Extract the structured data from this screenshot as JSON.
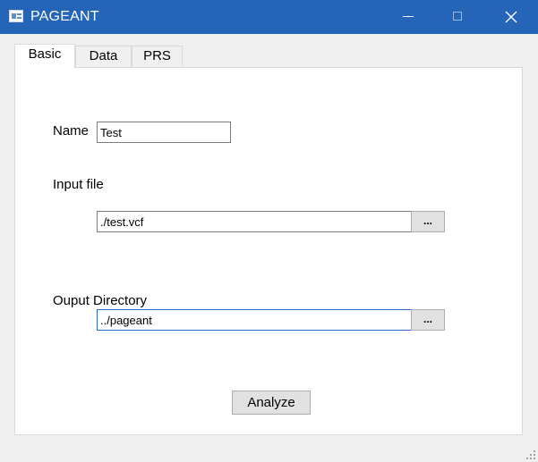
{
  "window": {
    "title": "PAGEANT",
    "icons": {
      "app": "window-app-icon",
      "minimize": "minimize-icon",
      "maximize": "maximize-icon",
      "close": "close-icon"
    },
    "colors": {
      "titlebar": "#2465b8",
      "focus_border": "#2a6fc4"
    }
  },
  "tabs": [
    {
      "label": "Basic",
      "selected": true
    },
    {
      "label": "Data",
      "selected": false
    },
    {
      "label": "PRS",
      "selected": false
    }
  ],
  "basic": {
    "name_label": "Name",
    "name_value": "Test",
    "input_file_label": "Input file",
    "input_file_value": "./test.vcf",
    "input_file_browse": "...",
    "output_dir_label": "Ouput Directory",
    "output_dir_value": "../pageant",
    "output_dir_browse": "...",
    "analyze_label": "Analyze"
  }
}
